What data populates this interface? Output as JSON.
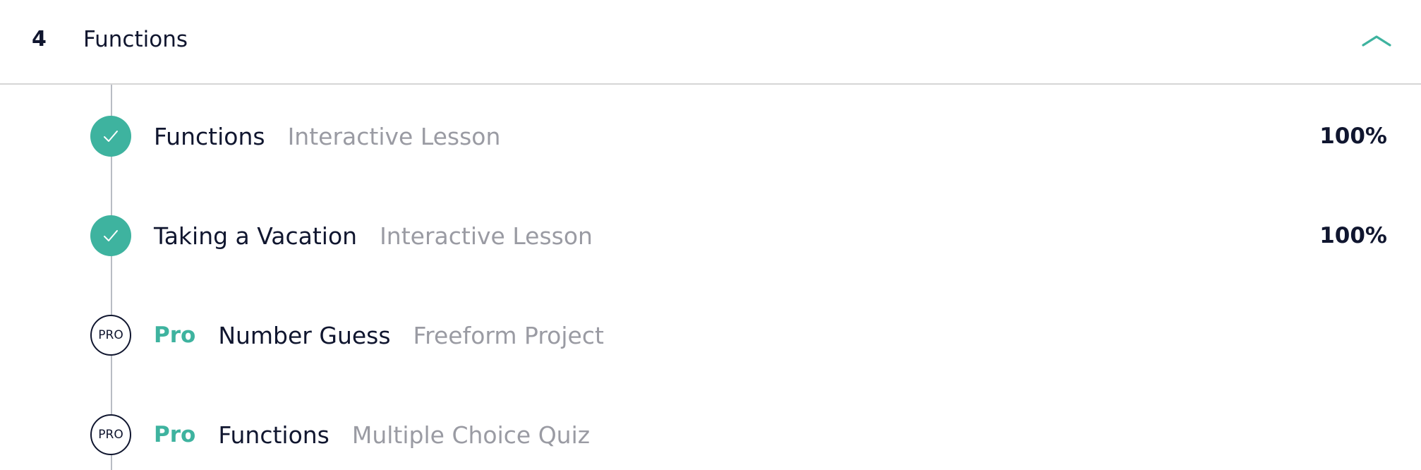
{
  "section": {
    "number": "4",
    "title": "Functions",
    "toggle_icon": "chevron-up-icon",
    "accent_color": "#3eb39f"
  },
  "items": [
    {
      "status": "completed",
      "status_icon": "check-icon",
      "title": "Functions",
      "type": "Interactive Lesson",
      "progress": "100%"
    },
    {
      "status": "completed",
      "status_icon": "check-icon",
      "title": "Taking a Vacation",
      "type": "Interactive Lesson",
      "progress": "100%"
    },
    {
      "status": "pro",
      "badge_text": "PRO",
      "pro_label": "Pro",
      "title": "Number Guess",
      "type": "Freeform Project"
    },
    {
      "status": "pro",
      "badge_text": "PRO",
      "pro_label": "Pro",
      "title": "Functions",
      "type": "Multiple Choice Quiz"
    }
  ]
}
